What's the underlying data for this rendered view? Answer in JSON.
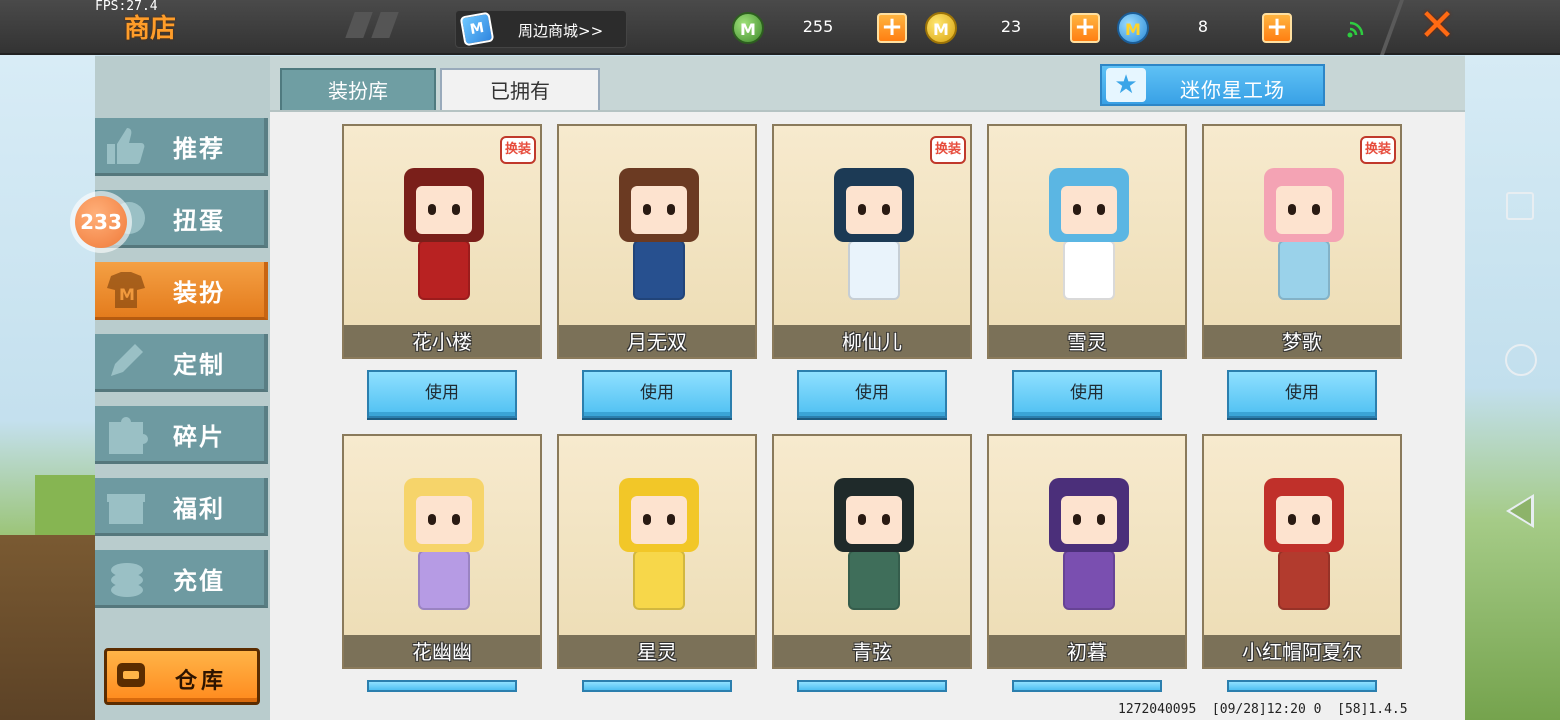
{
  "status": {
    "fps": "FPS:27.4"
  },
  "header": {
    "title": "商店",
    "mall_button": "周边商城>>",
    "currencies": [
      {
        "name": "mini-bean",
        "value": "255",
        "color": "#4a9a34"
      },
      {
        "name": "mini-coin",
        "value": "23",
        "color": "#f2c21b"
      },
      {
        "name": "star-coin",
        "value": "8",
        "color": "#2a8ad6"
      }
    ],
    "plus_label": "+",
    "close_label": "✕"
  },
  "sidebar": {
    "items": [
      {
        "label": "推荐",
        "icon": "thumbs-up-icon"
      },
      {
        "label": "扭蛋",
        "icon": "gacha-icon"
      },
      {
        "label": "装扮",
        "icon": "shirt-icon",
        "active": true
      },
      {
        "label": "定制",
        "icon": "pencil-icon"
      },
      {
        "label": "碎片",
        "icon": "puzzle-icon"
      },
      {
        "label": "福利",
        "icon": "gift-icon"
      },
      {
        "label": "充值",
        "icon": "coins-icon"
      }
    ],
    "badge": "233",
    "warehouse_label": "仓库"
  },
  "tabs": {
    "library": "装扮库",
    "owned": "已拥有"
  },
  "mini_star_factory": "迷你星工场",
  "tag_label": "换装",
  "characters": [
    {
      "name": "花小楼",
      "hair": "#7a1f1a",
      "outfit": "#b82222",
      "tag": true
    },
    {
      "name": "月无双",
      "hair": "#6b3a22",
      "outfit": "#27508f",
      "tag": false
    },
    {
      "name": "柳仙儿",
      "hair": "#1c3a55",
      "outfit": "#e9f3fb",
      "tag": true
    },
    {
      "name": "雪灵",
      "hair": "#5bb6e3",
      "outfit": "#ffffff",
      "tag": false
    },
    {
      "name": "梦歌",
      "hair": "#f4a3b4",
      "outfit": "#9ad2ea",
      "tag": true
    },
    {
      "name": "花幽幽",
      "hair": "#f6d46a",
      "outfit": "#b69be4",
      "tag": false
    },
    {
      "name": "星灵",
      "hair": "#f2c728",
      "outfit": "#f7d74a",
      "tag": false
    },
    {
      "name": "青弦",
      "hair": "#1f2a2a",
      "outfit": "#3f6e5a",
      "tag": false
    },
    {
      "name": "初暮",
      "hair": "#4b2f7a",
      "outfit": "#7a4fb0",
      "tag": false
    },
    {
      "name": "小红帽阿夏尔",
      "hair": "#c0302a",
      "outfit": "#b23b2e",
      "tag": false
    }
  ],
  "use_label": "使用",
  "footer": "1272040095  [09/28]12:20 0  [58]1.4.5"
}
